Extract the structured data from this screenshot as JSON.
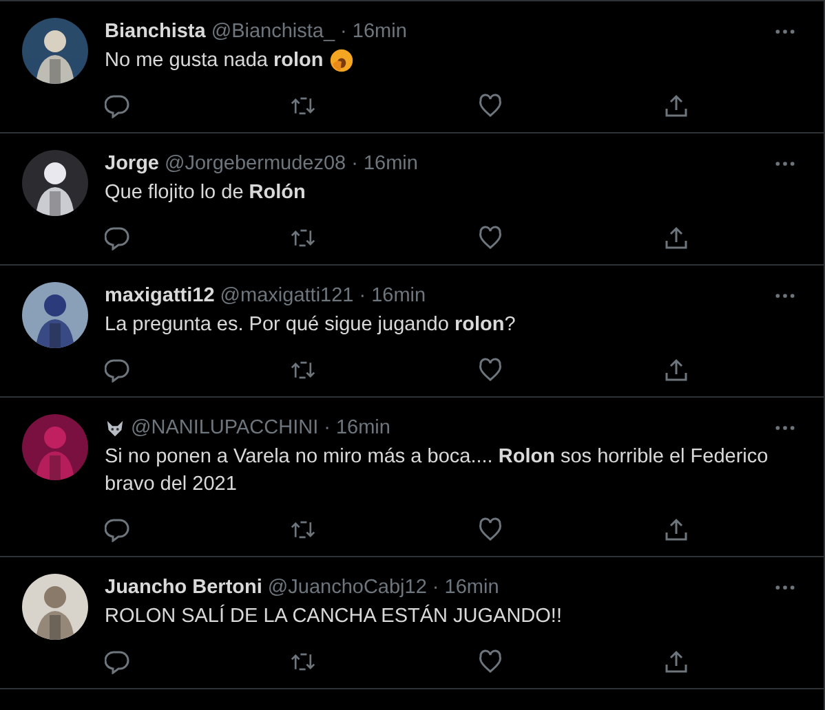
{
  "tweets": [
    {
      "name": "Bianchista",
      "handle": "@Bianchista_",
      "time": "· 16min",
      "text": "No me gusta nada **rolon**",
      "emoji": true,
      "name_emoji": false
    },
    {
      "name": "Jorge",
      "handle": "@Jorgebermudez08",
      "time": "· 16min",
      "text": "Que flojito lo de **Rolón**",
      "emoji": false,
      "name_emoji": false
    },
    {
      "name": "maxigatti12",
      "handle": "@maxigatti121",
      "time": "· 16min",
      "text": "La pregunta es. Por qué sigue jugando **rolon**?",
      "emoji": false,
      "name_emoji": false
    },
    {
      "handle": "@NANILUPACCHINI",
      "time": "· 16min",
      "text": "Si no ponen a Varela no miro más a boca.... **Rolon** sos horrible el Federico bravo del 2021",
      "emoji": false,
      "name_emoji": true
    },
    {
      "name": "Juancho Bertoni",
      "handle": "@JuanchoCabj12",
      "time": "· 16min",
      "text": "ROLON SALÍ DE LA CANCHA ESTÁN JUGANDO!!",
      "emoji": false,
      "name_emoji": false
    }
  ]
}
